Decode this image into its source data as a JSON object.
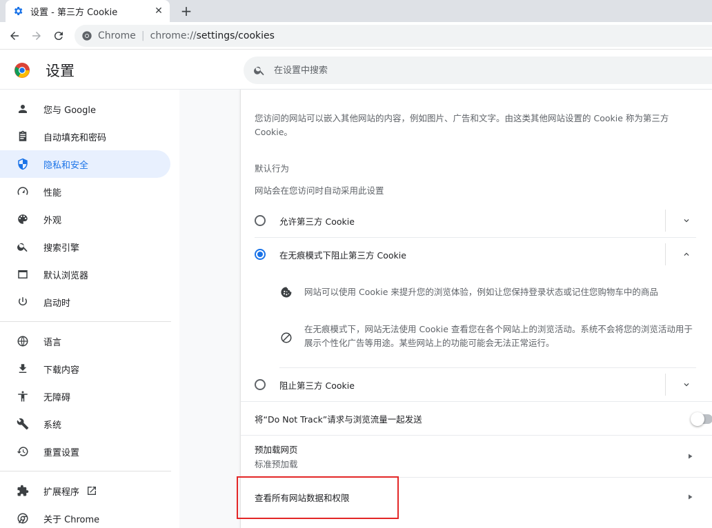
{
  "tab": {
    "title": "设置 - 第三方 Cookie",
    "close": "✕",
    "new_tab": "+"
  },
  "omnibox": {
    "label": "Chrome",
    "separator": "|",
    "scheme": "chrome://",
    "path": "settings/cookies"
  },
  "header": {
    "title": "设置",
    "search_placeholder": "在设置中搜索"
  },
  "sidebar": {
    "items": [
      {
        "label": "您与 Google",
        "icon": "person-icon"
      },
      {
        "label": "自动填充和密码",
        "icon": "clipboard-icon"
      },
      {
        "label": "隐私和安全",
        "icon": "shield-icon",
        "active": true
      },
      {
        "label": "性能",
        "icon": "speedometer-icon"
      },
      {
        "label": "外观",
        "icon": "palette-icon"
      },
      {
        "label": "搜索引擎",
        "icon": "search-icon"
      },
      {
        "label": "默认浏览器",
        "icon": "browser-icon"
      },
      {
        "label": "启动时",
        "icon": "power-icon"
      },
      {
        "label": "语言",
        "icon": "globe-icon"
      },
      {
        "label": "下载内容",
        "icon": "download-icon"
      },
      {
        "label": "无障碍",
        "icon": "accessibility-icon"
      },
      {
        "label": "系统",
        "icon": "wrench-icon"
      },
      {
        "label": "重置设置",
        "icon": "history-icon"
      },
      {
        "label": "扩展程序",
        "icon": "puzzle-icon"
      },
      {
        "label": "关于 Chrome",
        "icon": "chrome-icon"
      }
    ]
  },
  "content": {
    "description": "您访问的网站可以嵌入其他网站的内容，例如图片、广告和文字。由这类其他网站设置的 Cookie 称为第三方 Cookie。",
    "default_heading": "默认行为",
    "default_sub": "网站会在您访问时自动采用此设置",
    "options": [
      {
        "label": "允许第三方 Cookie",
        "checked": false
      },
      {
        "label": "在无痕模式下阻止第三方 Cookie",
        "checked": true
      },
      {
        "label": "阻止第三方 Cookie",
        "checked": false
      }
    ],
    "details": [
      {
        "icon": "cookie-icon",
        "text": "网站可以使用 Cookie 来提升您的浏览体验，例如让您保持登录状态或记住您购物车中的商品"
      },
      {
        "icon": "block-icon",
        "text": "在无痕模式下，网站无法使用 Cookie 查看您在各个网站上的浏览活动。系统不会将您的浏览活动用于展示个性化广告等用途。某些网站上的功能可能会无法正常运行。"
      }
    ],
    "dnt_label": "将“Do Not Track”请求与浏览流量一起发送",
    "preload_title": "预加载网页",
    "preload_sub": "标准预加载",
    "site_data_label": "查看所有网站数据和权限"
  },
  "colors": {
    "accent": "#1a73e8",
    "active_bg": "#e8f0fe",
    "highlight": "#e32626"
  }
}
